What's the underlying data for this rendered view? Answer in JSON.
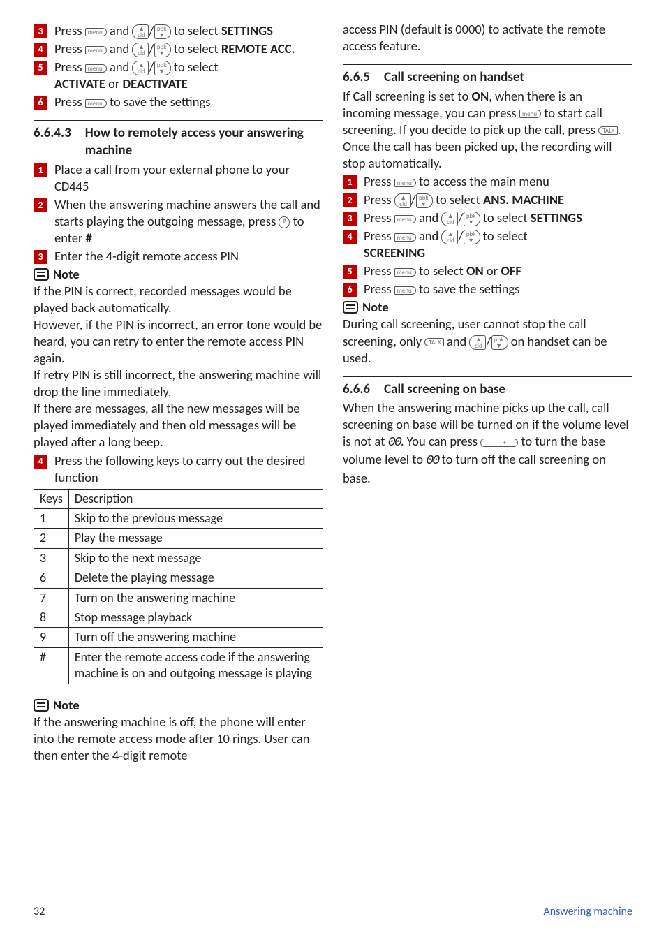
{
  "left": {
    "step3": {
      "prefix": "Press",
      "suffix_a": "and",
      "suffix_b": "to select",
      "target": "SETTINGS"
    },
    "step4": {
      "prefix": "Press",
      "suffix_a": "and",
      "suffix_b": "to select",
      "target": "REMOTE ACC."
    },
    "step5": {
      "prefix": "Press",
      "suffix_a": "and",
      "suffix_b": "to select",
      "target_a": "ACTIVATE",
      "or": "or",
      "target_b": "DEACTIVATE"
    },
    "step6": {
      "prefix": "Press",
      "suffix": "to save the settings"
    },
    "h_6643_num": "6.6.4.3",
    "h_6643_title": "How to remotely access your answering machine",
    "s1": "Place a call from your external phone to your CD445",
    "s2_a": "When the answering machine answers the call and starts playing the outgoing message, press",
    "s2_b": "to enter",
    "s2_hash": "#",
    "s3": "Enter the 4-digit remote access PIN",
    "note": "Note",
    "note_body": "If the PIN is correct, recorded messages would be played back automatically.\nHowever, if the PIN is incorrect, an error tone would be heard, you can retry to enter the remote access PIN again.\nIf retry PIN is still incorrect, the answering machine will drop the line immediately.\nIf there are messages, all the new messages will be played immediately and then old messages will be played after a long beep.",
    "s4": "Press the following keys to carry out the desired function",
    "table_head_k": "Keys",
    "table_head_d": "Description",
    "rows": [
      {
        "k": "1",
        "d": "Skip to the previous message"
      },
      {
        "k": "2",
        "d": "Play the message"
      },
      {
        "k": "3",
        "d": "Skip to the next message"
      },
      {
        "k": "6",
        "d": "Delete the playing message"
      },
      {
        "k": "7",
        "d": "Turn on the answering machine"
      },
      {
        "k": "8",
        "d": "Stop message playback"
      },
      {
        "k": "9",
        "d": "Turn off the answering machine"
      },
      {
        "k": "#",
        "d": "Enter the remote access code if the answering machine is on and outgoing message is playing"
      }
    ],
    "note2_body": "If the answering machine is off, the phone will enter into the remote access mode after 10 rings. User can then enter the 4-digit remote"
  },
  "right": {
    "cont": "access PIN (default is 0000) to activate the remote access feature.",
    "h665_num": "6.6.5",
    "h665_title": "Call screening on handset",
    "p665_a": "If Call screening is set to",
    "on": "ON",
    "p665_b": ", when there is an incoming message, you can press",
    "p665_c": "to start call screening. If you decide to pick up the call, press",
    "p665_d": ". Once the call has been picked up, the recording will stop automatically.",
    "r1_a": "Press",
    "r1_b": "to access the main menu",
    "r2_a": "Press",
    "r2_b": "to select",
    "r2_t": "ANS. MACHINE",
    "r3_a": "Press",
    "r3_b": "and",
    "r3_c": "to select",
    "r3_t": "SETTINGS",
    "r4_a": "Press",
    "r4_b": "and",
    "r4_c": "to select",
    "r4_t": "SCREENING",
    "r5_a": "Press",
    "r5_b": "to select",
    "r5_on": "ON",
    "r5_or": "or",
    "r5_off": "OFF",
    "r6_a": "Press",
    "r6_b": "to save the settings",
    "note": "Note",
    "note_body_a": "During call screening, user cannot stop the call screening, only",
    "note_body_b": "and",
    "note_body_c": "on handset can be used.",
    "h666_num": "6.6.6",
    "h666_title": "Call screening on base",
    "p666_a": "When the answering machine picks up the call, call screening on base will be turned on if the volume level is not at",
    "seg1": "00",
    "p666_b": ". You can press",
    "p666_c": "to turn the base volume level to",
    "seg2": "00",
    "p666_d": "to turn off the call screening on base."
  },
  "footer": {
    "page": "32",
    "section": "Answering machine"
  }
}
